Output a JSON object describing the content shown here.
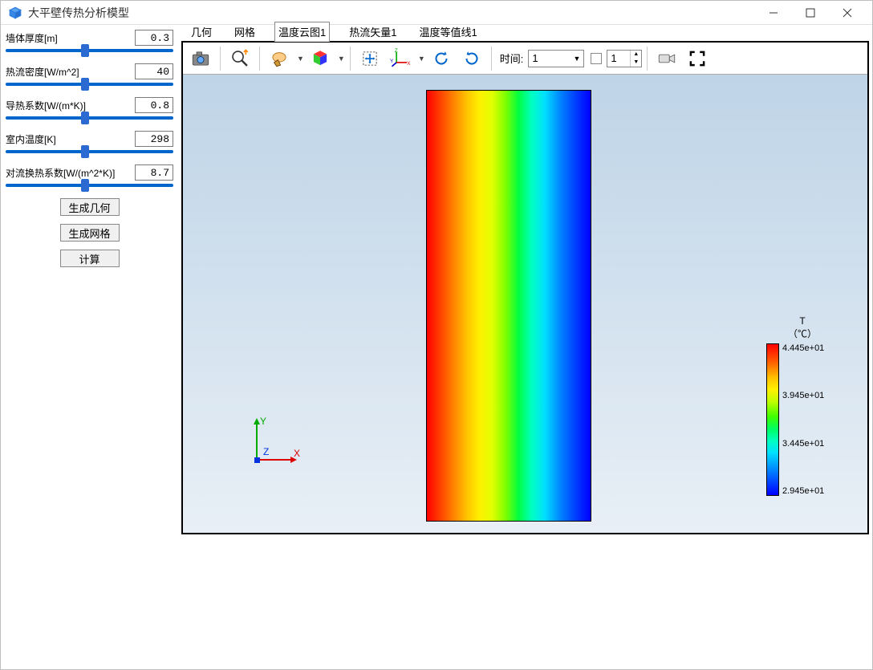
{
  "window": {
    "title": "大平壁传热分析模型"
  },
  "params": {
    "thickness": {
      "label": "墙体厚度[m]",
      "value": "0.3"
    },
    "heatflux": {
      "label": "热流密度[W/m^2]",
      "value": "40"
    },
    "conductivity": {
      "label": "导热系数[W/(m*K)]",
      "value": "0.8"
    },
    "temp_indoor": {
      "label": "室内温度[K]",
      "value": "298"
    },
    "conv_coeff": {
      "label": "对流换热系数[W/(m^2*K)]",
      "value": "8.7"
    }
  },
  "buttons": {
    "gen_geom": "生成几何",
    "gen_mesh": "生成网格",
    "compute": "计算"
  },
  "tabs": {
    "geometry": "几何",
    "mesh": "网格",
    "temp_contour": "温度云图1",
    "heat_vector": "热流矢量1",
    "temp_isoline": "温度等值线1",
    "active_index": 2
  },
  "toolbar": {
    "time_label": "时间:",
    "time_value": "1",
    "step_value": "1"
  },
  "axis": {
    "x": "X",
    "y": "Y",
    "z": "Z"
  },
  "legend": {
    "title": "T",
    "unit": "（℃）",
    "ticks": [
      "4.445e+01",
      "3.945e+01",
      "3.445e+01",
      "2.945e+01"
    ]
  },
  "chart_data": {
    "type": "heatmap",
    "title": "T （℃）",
    "variable": "Temperature",
    "unit": "℃",
    "colormap": "rainbow",
    "value_range": [
      29.45,
      44.45
    ],
    "color_ticks": [
      44.45,
      39.45,
      34.45,
      29.45
    ],
    "gradient_direction": "x",
    "note": "Linear temperature distribution across wall thickness; left edge at ~44.45℃ (hot), right edge at ~29.45℃ (cold)."
  }
}
